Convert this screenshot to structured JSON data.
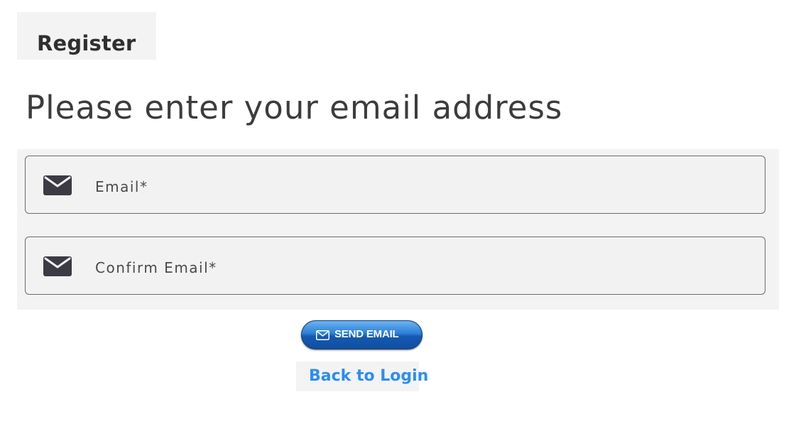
{
  "tabs": {
    "register_label": "Register"
  },
  "form": {
    "heading": "Please enter your email address",
    "email_field": {
      "label": "Email*",
      "icon": "envelope-icon",
      "value": ""
    },
    "confirm_email_field": {
      "label": "Confirm Email*",
      "icon": "envelope-icon",
      "value": ""
    },
    "send_button": {
      "label": "SEND EMAIL",
      "icon": "envelope-icon"
    },
    "back_link": {
      "label": "Back to Login"
    }
  },
  "colors": {
    "panel_background": "#f4f3f4",
    "link": "#2b8ef0",
    "button_blue": "#1f6fd0",
    "icon_dark": "#3c3b44"
  }
}
